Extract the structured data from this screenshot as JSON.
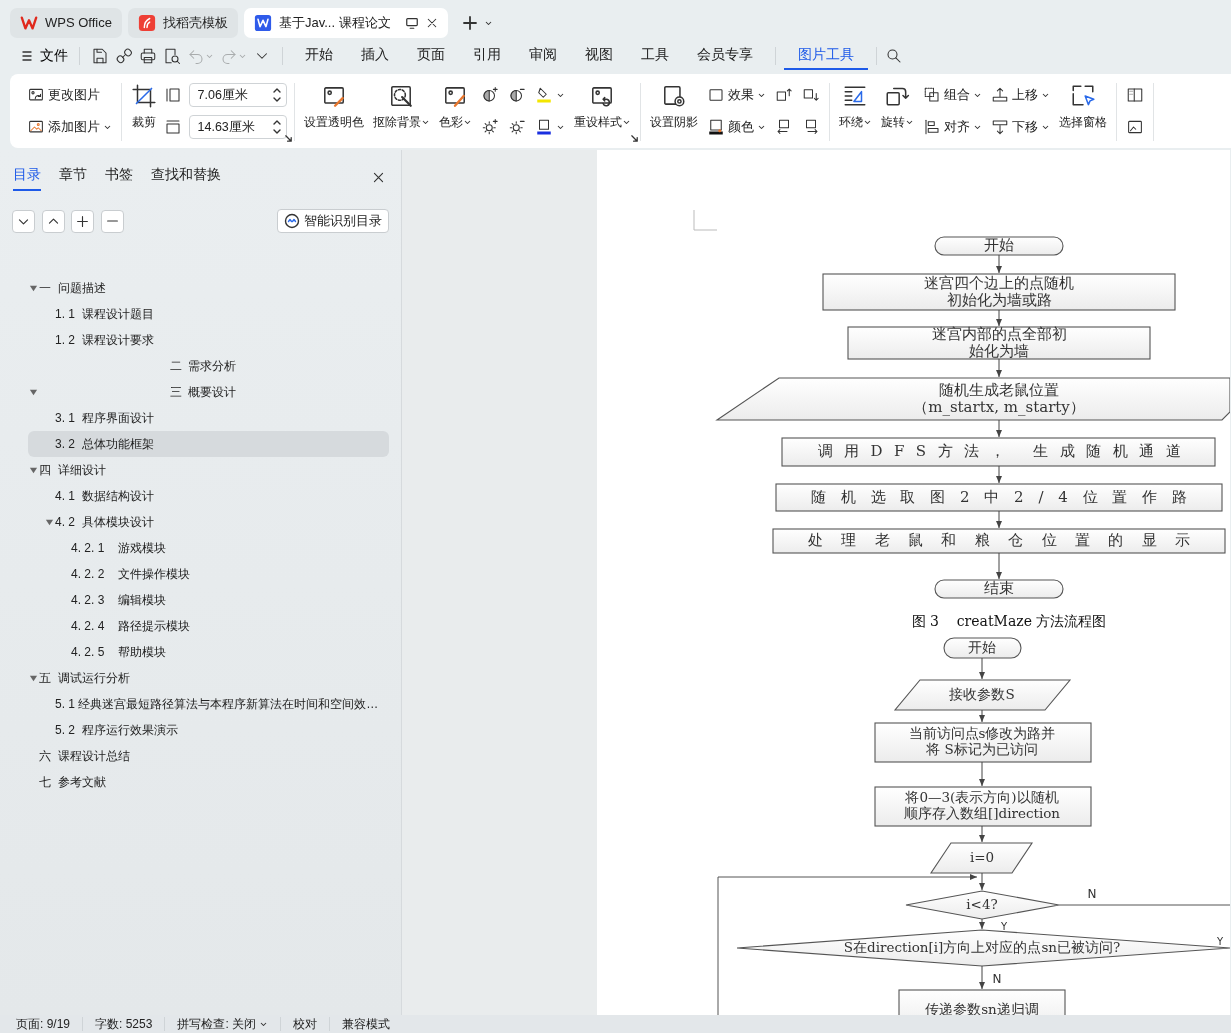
{
  "tabs": [
    {
      "label": "WPS Office",
      "kind": "home",
      "selected": false
    },
    {
      "label": "找稻壳模板",
      "kind": "templates",
      "selected": false
    },
    {
      "label": "基于Jav... 课程论文",
      "kind": "document",
      "selected": true
    }
  ],
  "menu": {
    "file_label": "文件",
    "quick_tools": [
      {
        "disabled": false
      },
      {
        "disabled": false
      },
      {
        "disabled": false
      },
      {
        "disabled": false
      },
      {
        "disabled": true
      },
      {
        "disabled": true
      },
      {
        "disabled": false
      }
    ],
    "menu_tabs": [
      {
        "label": "开始",
        "selected": false
      },
      {
        "label": "插入",
        "selected": false
      },
      {
        "label": "页面",
        "selected": false
      },
      {
        "label": "引用",
        "selected": false
      },
      {
        "label": "审阅",
        "selected": false
      },
      {
        "label": "视图",
        "selected": false
      },
      {
        "label": "工具",
        "selected": false
      },
      {
        "label": "会员专享",
        "selected": false
      },
      {
        "label": "图片工具",
        "selected": true
      }
    ]
  },
  "ribbon": {
    "groups": [
      {
        "launcher": false,
        "columns": [
          [
            {
              "kind": "small",
              "label": "更改图片",
              "dropdown": false
            },
            {
              "kind": "small",
              "label": "添加图片",
              "dropdown": true
            }
          ]
        ]
      },
      {
        "launcher": true,
        "columns": [
          [
            {
              "kind": "large",
              "label": "裁剪",
              "dropdown": false
            }
          ],
          [
            {
              "kind": "field",
              "value": "7.06厘米"
            },
            {
              "kind": "field",
              "value": "14.63厘米"
            }
          ]
        ]
      },
      {
        "launcher": true,
        "columns": [
          [
            {
              "kind": "large",
              "label": "设置透明色",
              "dropdown": false
            }
          ],
          [
            {
              "kind": "large",
              "label": "抠除背景",
              "dropdown": true
            }
          ],
          [
            {
              "kind": "large",
              "label": "色彩",
              "dropdown": true
            }
          ],
          [
            {
              "kind": "icon",
              "dropdown": false
            },
            {
              "kind": "icon",
              "dropdown": false
            }
          ],
          [
            {
              "kind": "icon",
              "dropdown": false
            },
            {
              "kind": "icon",
              "dropdown": false
            }
          ],
          [
            {
              "kind": "icon",
              "dropdown": true
            },
            {
              "kind": "icon",
              "dropdown": true
            }
          ],
          [
            {
              "kind": "large",
              "label": "重设样式",
              "dropdown": true
            }
          ]
        ]
      },
      {
        "launcher": false,
        "columns": [
          [
            {
              "kind": "large",
              "label": "设置阴影",
              "dropdown": false
            }
          ],
          [
            {
              "kind": "small",
              "label": "效果",
              "dropdown": true
            },
            {
              "kind": "small",
              "label": "颜色",
              "dropdown": true
            }
          ],
          [
            {
              "kind": "icon",
              "dropdown": false
            },
            {
              "kind": "icon",
              "dropdown": false
            }
          ],
          [
            {
              "kind": "icon",
              "dropdown": false
            },
            {
              "kind": "icon",
              "dropdown": false
            }
          ]
        ]
      },
      {
        "launcher": false,
        "columns": [
          [
            {
              "kind": "large",
              "label": "环绕",
              "dropdown": true
            }
          ],
          [
            {
              "kind": "large",
              "label": "旋转",
              "dropdown": true
            }
          ],
          [
            {
              "kind": "small",
              "label": "组合",
              "dropdown": true
            },
            {
              "kind": "small",
              "label": "对齐",
              "dropdown": true
            }
          ],
          [
            {
              "kind": "small",
              "label": "上移",
              "dropdown": true
            },
            {
              "kind": "small",
              "label": "下移",
              "dropdown": true
            }
          ],
          [
            {
              "kind": "large",
              "label": "选择窗格",
              "dropdown": false
            }
          ]
        ]
      },
      {
        "launcher": false,
        "columns": [
          [
            {
              "kind": "icon",
              "dropdown": false
            },
            {
              "kind": "icon",
              "dropdown": false
            }
          ]
        ]
      }
    ]
  },
  "nav_panel": {
    "tabs": [
      {
        "label": "目录",
        "selected": true
      },
      {
        "label": "章节",
        "selected": false
      },
      {
        "label": "书签",
        "selected": false
      },
      {
        "label": "查找和替换",
        "selected": false
      }
    ],
    "smart_button": "智能识别目录",
    "outline": [
      {
        "label": "一  问题描述",
        "centered": false,
        "selected": false,
        "expanded": true,
        "children": [
          {
            "label": "1. 1  课程设计题目",
            "selected": false
          },
          {
            "label": "1. 2  课程设计要求",
            "selected": false
          }
        ]
      },
      {
        "label": "二  需求分析",
        "centered": true,
        "selected": false
      },
      {
        "label": "三  概要设计",
        "centered": true,
        "selected": false,
        "expanded": true,
        "children": [
          {
            "label": "3. 1  程序界面设计",
            "selected": false
          },
          {
            "label": "3. 2  总体功能框架",
            "selected": true
          }
        ]
      },
      {
        "label": "四  详细设计",
        "centered": false,
        "selected": false,
        "expanded": true,
        "children": [
          {
            "label": "4. 1  数据结构设计",
            "selected": false
          },
          {
            "label": "4. 2  具体模块设计",
            "selected": false,
            "expanded": true,
            "children": [
              {
                "label": "4. 2. 1    游戏模块",
                "selected": false
              },
              {
                "label": "4. 2. 2    文件操作模块",
                "selected": false
              },
              {
                "label": "4. 2. 3    编辑模块",
                "selected": false
              },
              {
                "label": "4. 2. 4    路径提示模块",
                "selected": false
              },
              {
                "label": "4. 2. 5    帮助模块",
                "selected": false
              }
            ]
          }
        ]
      },
      {
        "label": "五  调试运行分析",
        "centered": false,
        "selected": false,
        "expanded": true,
        "children": [
          {
            "label": "5. 1 经典迷宫最短路径算法与本程序新算法在时间和空间效…",
            "selected": false
          },
          {
            "label": "5. 2  程序运行效果演示",
            "selected": false
          }
        ]
      },
      {
        "label": "六  课程设计总结",
        "centered": false,
        "selected": false
      },
      {
        "label": "七  参考文献",
        "centered": false,
        "selected": false
      }
    ]
  },
  "document": {
    "flowchart_1": {
      "nodes": [
        {
          "kind": "terminal",
          "lines": [
            "开始"
          ]
        },
        {
          "kind": "process",
          "lines": [
            "迷宫四个边上的点随机",
            "初始化为墙或路"
          ]
        },
        {
          "kind": "process",
          "lines": [
            "迷宫内部的点全部初",
            "始化为墙"
          ]
        },
        {
          "kind": "io",
          "lines": [
            "随机生成老鼠位置",
            "（m_startx, m_starty）"
          ]
        },
        {
          "kind": "process",
          "lines": [
            "调用DFS方法， 生成随机通道"
          ]
        },
        {
          "kind": "process",
          "lines": [
            "随机选取图2中2/4位置作路"
          ]
        },
        {
          "kind": "process",
          "lines": [
            "处理老鼠和粮仓位置的显示"
          ]
        },
        {
          "kind": "terminal",
          "lines": [
            "结束"
          ]
        }
      ]
    },
    "caption": "图 3    creatMaze 方法流程图",
    "flowchart_2": {
      "nodes": [
        {
          "kind": "terminal",
          "lines": [
            "开始"
          ]
        },
        {
          "kind": "io",
          "lines": [
            "接收参数S"
          ]
        },
        {
          "kind": "process",
          "lines": [
            "当前访问点s修改为路并",
            "将 S标记为已访问"
          ]
        },
        {
          "kind": "process",
          "lines": [
            "将0—3(表示方向)以随机",
            "顺序存入数组[]direction"
          ]
        },
        {
          "kind": "io",
          "lines": [
            "i=0"
          ]
        },
        {
          "kind": "decision",
          "lines": [
            "i<4?"
          ]
        },
        {
          "kind": "decision",
          "lines": [
            "S在direction[i]方向上对应的点sn已被访问?"
          ]
        },
        {
          "kind": "process",
          "lines": [
            "传递参数sn递归调"
          ]
        }
      ],
      "branch_labels": [
        "N",
        "Y",
        "Y",
        "N"
      ]
    }
  },
  "status_bar": [
    {
      "text": "页面: 9/19",
      "dropdown": false
    },
    {
      "text": "字数: 5253",
      "dropdown": false
    },
    {
      "text": "拼写检查: 关闭",
      "dropdown": true
    },
    {
      "text": "校对",
      "dropdown": false
    },
    {
      "text": "兼容模式",
      "dropdown": false
    }
  ]
}
